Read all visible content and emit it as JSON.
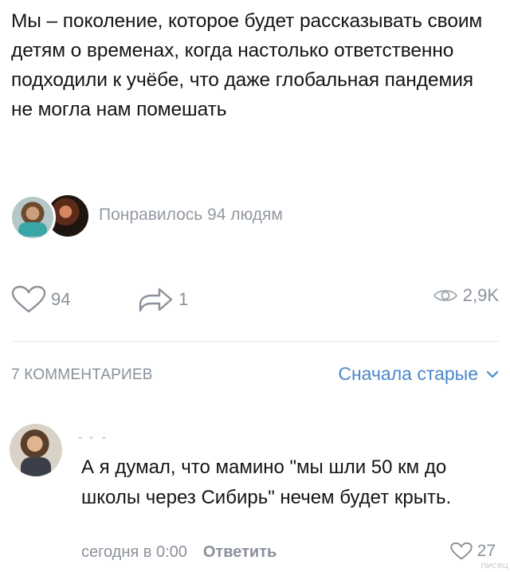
{
  "post": {
    "text": "Мы – поколение, которое будет рассказывать своим детям о временах, когда настолько ответственно подходили к учёбе, что даже глобальная пандемия не могла нам помешать"
  },
  "likes_summary": {
    "text": "Понравилось 94 людям"
  },
  "actions": {
    "like_count": "94",
    "share_count": "1",
    "views_count": "2,9K",
    "icons": {
      "like": "heart-icon",
      "share": "share-arrow-icon",
      "views": "eye-icon"
    }
  },
  "comments": {
    "count_label": "7 КОММЕНТАРИЕВ",
    "sort_label": "Сначала старые",
    "items": [
      {
        "text": "А я думал, что мамино \"мы шли 50 км до школы через Сибирь\" нечем будет крыть.",
        "time": "сегодня в 0:00",
        "reply_label": "Ответить",
        "like_count": "27"
      }
    ]
  },
  "watermark": "писец",
  "colors": {
    "accent": "#4a86c8",
    "muted": "#8a919a",
    "text": "#151515"
  }
}
